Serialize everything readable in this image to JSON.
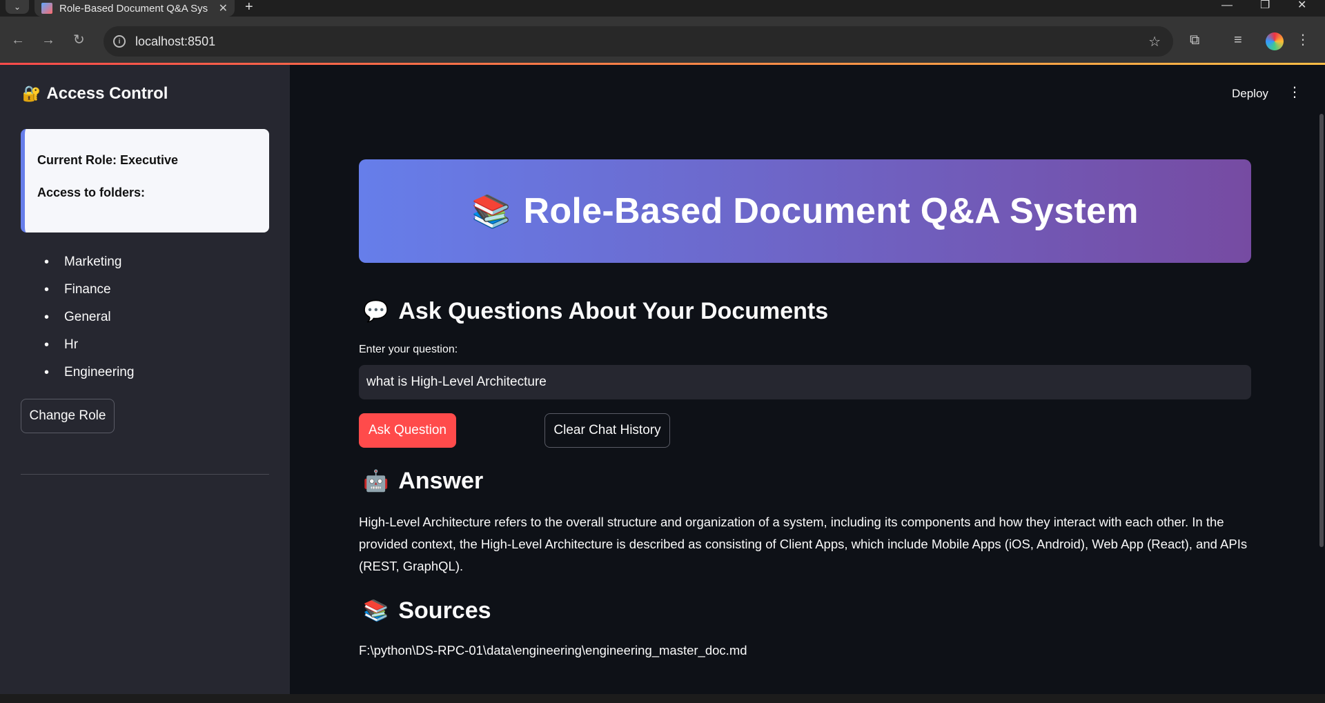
{
  "browser": {
    "tab_title": "Role-Based Document Q&A Sys",
    "url": "localhost:8501"
  },
  "sidebar": {
    "title": "Access Control",
    "title_icon": "locked-with-key-icon",
    "current_role": "Current Role: Executive",
    "access_label": "Access to folders:",
    "folders": [
      "Marketing",
      "Finance",
      "General",
      "Hr",
      "Engineering"
    ],
    "change_role_label": "Change Role"
  },
  "header": {
    "deploy_label": "Deploy"
  },
  "main": {
    "banner_title": "Role-Based Document Q&A System",
    "banner_icon": "books-icon",
    "ask_heading": "Ask Questions About Your Documents",
    "ask_icon": "speech-bubble-icon",
    "question_label": "Enter your question:",
    "question_value": "what is High-Level Architecture",
    "ask_button": "Ask Question",
    "clear_button": "Clear Chat History",
    "answer_heading": "Answer",
    "answer_icon": "robot-icon",
    "answer_text": "High-Level Architecture refers to the overall structure and organization of a system, including its components and how they interact with each other. In the provided context, the High-Level Architecture is described as consisting of Client Apps, which include Mobile Apps (iOS, Android), Web App (React), and APIs (REST, GraphQL).",
    "sources_heading": "Sources",
    "sources_icon": "books-icon",
    "source_path": "F:\\python\\DS-RPC-01\\data\\engineering\\engineering_master_doc.md"
  },
  "colors": {
    "accent_red": "#ff4b4b",
    "banner_start": "#667eea",
    "banner_end": "#764ba2",
    "sidebar_bg": "#262730",
    "main_bg": "#0e1117"
  }
}
